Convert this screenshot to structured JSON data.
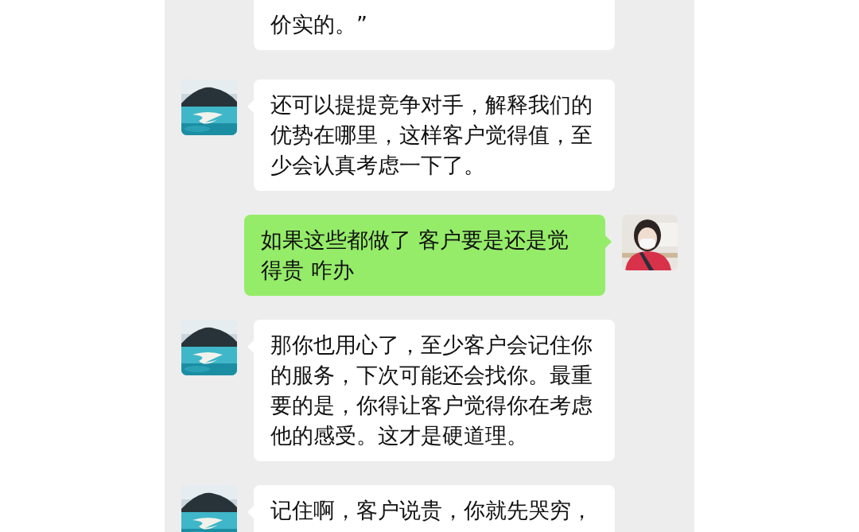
{
  "messages": [
    {
      "kind": "received",
      "text": "价实的。”"
    },
    {
      "kind": "received",
      "text": "还可以提提竞争对手，解释我们的优势在哪里，这样客户觉得值，至少会认真考虑一下了。"
    },
    {
      "kind": "sent",
      "text": "如果这些都做了 客户要是还是觉得贵 咋办"
    },
    {
      "kind": "received",
      "text": "那你也用心了，至少客户会记住你的服务，下次可能还会找你。最重要的是，你得让客户觉得你在考虑他的感受。这才是硬道理。"
    },
    {
      "kind": "received",
      "text": "记住啊，客户说贵，你就先哭穷，"
    }
  ]
}
